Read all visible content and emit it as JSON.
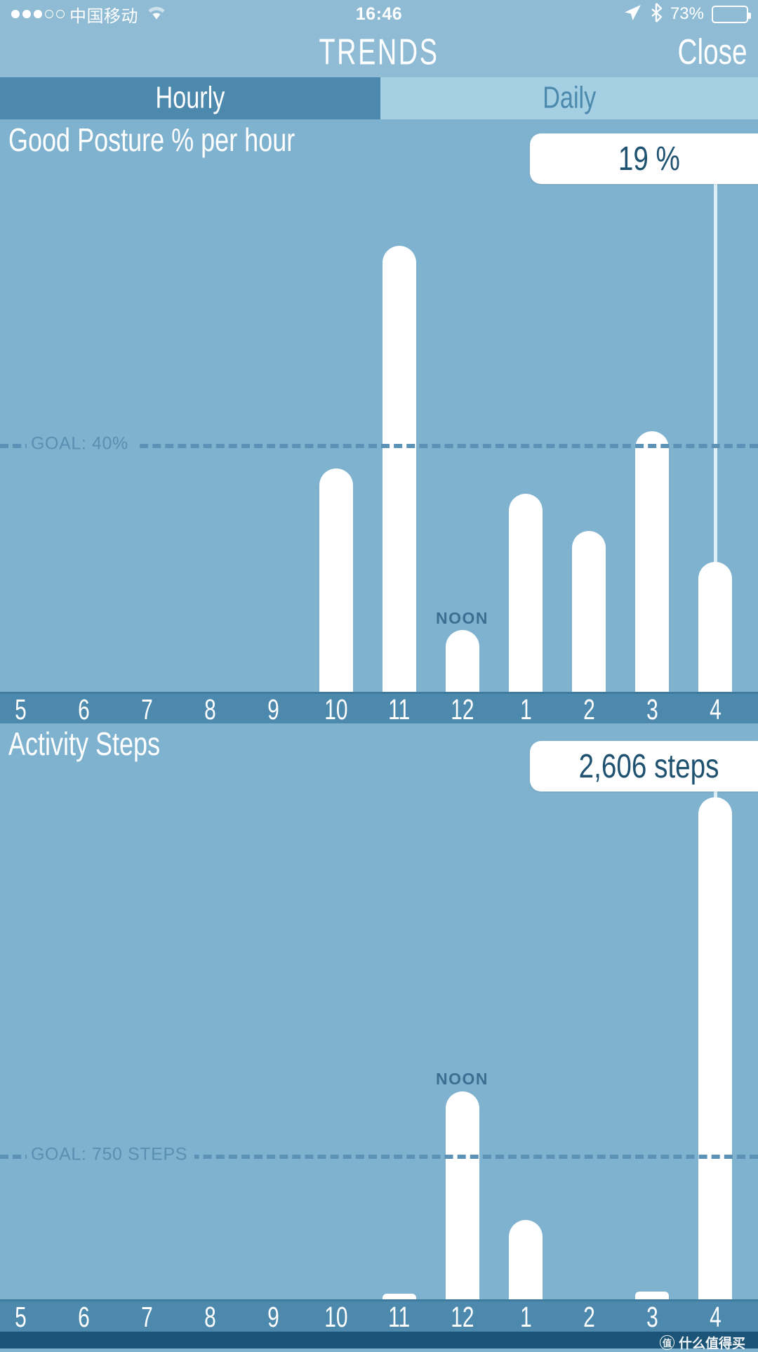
{
  "statusbar": {
    "signal_dots_filled": 3,
    "signal_dots_total": 5,
    "carrier": "中国移动",
    "wifi_icon": "wifi-icon",
    "time": "16:46",
    "location_icon": "location-arrow-icon",
    "bluetooth_icon": "bluetooth-icon",
    "battery_percent": "73%",
    "battery_level": 73
  },
  "navbar": {
    "title": "TRENDS",
    "close_label": "Close"
  },
  "tabs": [
    {
      "label": "Hourly",
      "selected": true
    },
    {
      "label": "Daily",
      "selected": false
    }
  ],
  "colors": {
    "status_bg": "#8fbcd4",
    "nav_bg": "#8fbcd4",
    "tab_active_bg": "#4c89ad",
    "tab_inactive_bg": "#a5d0e4",
    "chart_bg": "#7fb2ce",
    "axis_bg": "#4c89ad",
    "bar": "#ffffff",
    "goal_line": "#5b92b5",
    "goal_label": "#5b8fb2",
    "noon_label": "#3c6e91",
    "tooltip_bg": "#ffffff",
    "tooltip_text": "#1f5270",
    "footer_bg": "#1b5476"
  },
  "footer": {
    "watermark_badge": "值",
    "watermark_text": "什么值得买"
  },
  "chart_data": [
    {
      "type": "bar",
      "title": "Good Posture % per hour",
      "xlabel": "",
      "ylabel": "",
      "ylim": [
        0,
        85
      ],
      "grid": false,
      "goal_label": "GOAL: 40%",
      "goal_value": 40,
      "noon_label": "NOON",
      "selected_category": "4",
      "selected_value_label": "19 %",
      "categories": [
        "5",
        "6",
        "7",
        "8",
        "9",
        "10",
        "11",
        "12",
        "1",
        "2",
        "3",
        "4"
      ],
      "values": [
        0,
        0,
        0,
        0,
        0,
        36,
        72,
        10,
        32,
        26,
        42,
        21
      ]
    },
    {
      "type": "bar",
      "title": "Activity Steps",
      "xlabel": "",
      "ylabel": "",
      "ylim": [
        0,
        2750
      ],
      "grid": false,
      "goal_label": "GOAL: 750 STEPS",
      "goal_value": 750,
      "noon_label": "NOON",
      "selected_category": "4",
      "selected_value_label": "2,606 steps",
      "categories": [
        "5",
        "6",
        "7",
        "8",
        "9",
        "10",
        "11",
        "12",
        "1",
        "2",
        "3",
        "4"
      ],
      "values": [
        0,
        0,
        0,
        0,
        0,
        0,
        30,
        1080,
        410,
        0,
        40,
        2606
      ]
    }
  ]
}
